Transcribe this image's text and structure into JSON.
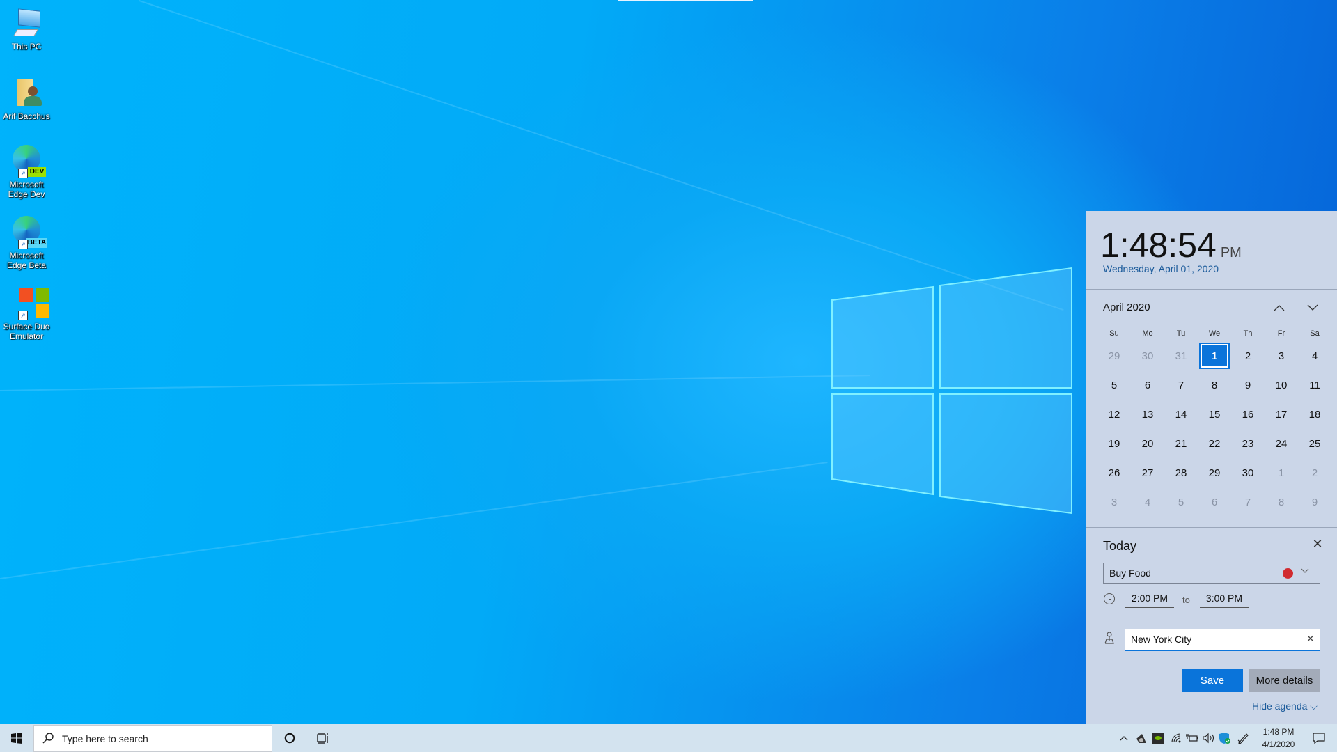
{
  "desktop": {
    "icons": [
      {
        "label": "This PC",
        "icon": "computer-icon"
      },
      {
        "label": "Arif Bacchus",
        "icon": "user-folder-icon"
      },
      {
        "label": "Microsoft Edge Dev",
        "icon": "edge-dev-icon",
        "badge": "DEV"
      },
      {
        "label": "Microsoft Edge Beta",
        "icon": "edge-beta-icon",
        "badge": "BETA"
      },
      {
        "label": "Surface Duo Emulator",
        "icon": "surface-duo-icon"
      }
    ]
  },
  "flyout": {
    "time": "1:48:54",
    "ampm": "PM",
    "date_long": "Wednesday, April 01, 2020",
    "month_label": "April 2020",
    "days_of_week": [
      "Su",
      "Mo",
      "Tu",
      "We",
      "Th",
      "Fr",
      "Sa"
    ],
    "weeks": [
      [
        {
          "d": "29",
          "o": true
        },
        {
          "d": "30",
          "o": true
        },
        {
          "d": "31",
          "o": true
        },
        {
          "d": "1",
          "today": true
        },
        {
          "d": "2"
        },
        {
          "d": "3"
        },
        {
          "d": "4"
        }
      ],
      [
        {
          "d": "5"
        },
        {
          "d": "6"
        },
        {
          "d": "7"
        },
        {
          "d": "8"
        },
        {
          "d": "9"
        },
        {
          "d": "10"
        },
        {
          "d": "11"
        }
      ],
      [
        {
          "d": "12"
        },
        {
          "d": "13"
        },
        {
          "d": "14"
        },
        {
          "d": "15"
        },
        {
          "d": "16"
        },
        {
          "d": "17"
        },
        {
          "d": "18"
        }
      ],
      [
        {
          "d": "19"
        },
        {
          "d": "20"
        },
        {
          "d": "21"
        },
        {
          "d": "22"
        },
        {
          "d": "23"
        },
        {
          "d": "24"
        },
        {
          "d": "25"
        }
      ],
      [
        {
          "d": "26"
        },
        {
          "d": "27"
        },
        {
          "d": "28"
        },
        {
          "d": "29"
        },
        {
          "d": "30"
        },
        {
          "d": "1",
          "o": true
        },
        {
          "d": "2",
          "o": true
        }
      ],
      [
        {
          "d": "3",
          "o": true
        },
        {
          "d": "4",
          "o": true
        },
        {
          "d": "5",
          "o": true
        },
        {
          "d": "6",
          "o": true
        },
        {
          "d": "7",
          "o": true
        },
        {
          "d": "8",
          "o": true
        },
        {
          "d": "9",
          "o": true
        }
      ]
    ],
    "agenda": {
      "title": "Today",
      "event_name": "Buy Food",
      "event_color": "#d12a2f",
      "start_time": "2:00 PM",
      "to_label": "to",
      "end_time": "3:00 PM",
      "location": "New York City",
      "save_label": "Save",
      "more_details_label": "More details",
      "hide_agenda_label": "Hide agenda ⌵"
    }
  },
  "taskbar": {
    "search_placeholder": "Type here to search",
    "clock_time": "1:48 PM",
    "clock_date": "4/1/2020",
    "tray_icons": [
      "chevron-up-icon",
      "speaker-app-icon",
      "nvidia-icon",
      "wifi-icon",
      "battery-icon",
      "volume-icon",
      "defender-icon",
      "pen-icon"
    ]
  },
  "colors": {
    "accent": "#0a74da",
    "flyout_bg": "#cbd6e8",
    "link": "#1a5a9a"
  }
}
